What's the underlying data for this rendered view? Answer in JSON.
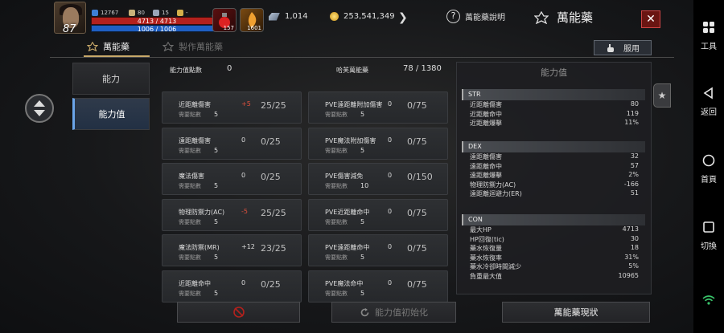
{
  "player": {
    "level": "87",
    "stat_a": "12767",
    "stat_b": "80",
    "stat_c": "15",
    "stat_d": "-",
    "hp": "4713 / 4713",
    "mp": "1006 / 1006"
  },
  "quickslots": [
    {
      "count": "157"
    },
    {
      "count": "1601"
    }
  ],
  "resources": {
    "diamonds": "1,014",
    "gold": "253,541,349"
  },
  "header": {
    "help_label": "萬能藥說明",
    "title": "萬能藥",
    "close": "✕"
  },
  "tabs": {
    "panacea": "萬能藥",
    "craft": "製作萬能藥",
    "use_button": "服用"
  },
  "sidemenu": [
    {
      "label": "能力"
    },
    {
      "label": "能力值"
    }
  ],
  "points": {
    "label": "能力值點數",
    "value": "0",
    "consumed_label": "哈芙萬能藥",
    "consumed_value": "78 / 1380"
  },
  "cards": [
    {
      "name": "近距離傷害",
      "sub": "需要點數",
      "pts": "5",
      "bonus": "+5",
      "value": "25/25",
      "color": "red"
    },
    {
      "name": "PVE遠距離附加傷害",
      "sub": "需要點數",
      "pts": "5",
      "bonus": "0",
      "value": "0/75",
      "color": "zero"
    },
    {
      "name": "遠距離傷害",
      "sub": "需要點數",
      "pts": "5",
      "bonus": "0",
      "value": "0/25",
      "color": "zero"
    },
    {
      "name": "PVE魔法附加傷害",
      "sub": "需要點數",
      "pts": "5",
      "bonus": "0",
      "value": "0/75",
      "color": "zero"
    },
    {
      "name": "魔法傷害",
      "sub": "需要點數",
      "pts": "5",
      "bonus": "0",
      "value": "0/25",
      "color": "zero"
    },
    {
      "name": "PVE傷害減免",
      "sub": "需要點數",
      "pts": "10",
      "bonus": "0",
      "value": "0/150",
      "color": "zero"
    },
    {
      "name": "物理防禦力(AC)",
      "sub": "需要點數",
      "pts": "5",
      "bonus": "-5",
      "value": "25/25",
      "color": "red"
    },
    {
      "name": "PVE近距離命中",
      "sub": "需要點數",
      "pts": "5",
      "bonus": "0",
      "value": "0/75",
      "color": "zero"
    },
    {
      "name": "魔法防禦(MR)",
      "sub": "需要點數",
      "pts": "5",
      "bonus": "+12",
      "value": "23/25",
      "color": "zero"
    },
    {
      "name": "PVE遠距離命中",
      "sub": "需要點數",
      "pts": "5",
      "bonus": "0",
      "value": "0/75",
      "color": "zero"
    },
    {
      "name": "近距離命中",
      "sub": "需要點數",
      "pts": "5",
      "bonus": "0",
      "value": "0/25",
      "color": "zero"
    },
    {
      "name": "PVE魔法命中",
      "sub": "需要點數",
      "pts": "5",
      "bonus": "0",
      "value": "0/75",
      "color": "zero"
    }
  ],
  "stats_panel": {
    "title": "能力值",
    "sections": [
      {
        "name": "STR",
        "rows": [
          {
            "label": "近距離傷害",
            "value": "80"
          },
          {
            "label": "近距離命中",
            "value": "119"
          },
          {
            "label": "近距離爆擊",
            "value": "11%"
          }
        ]
      },
      {
        "name": "DEX",
        "rows": [
          {
            "label": "遠距離傷害",
            "value": "32"
          },
          {
            "label": "遠距離命中",
            "value": "57"
          },
          {
            "label": "遠距離爆擊",
            "value": "2%"
          },
          {
            "label": "物理防禦力(AC)",
            "value": "-166"
          },
          {
            "label": "遠距離迴避力(ER)",
            "value": "51"
          }
        ]
      },
      {
        "name": "CON",
        "rows": [
          {
            "label": "最大HP",
            "value": "4713"
          },
          {
            "label": "HP回復(tic)",
            "value": "30"
          },
          {
            "label": "藥水恢復量",
            "value": "18"
          },
          {
            "label": "藥水恢復率",
            "value": "31%"
          },
          {
            "label": "藥水冷卻時間減少",
            "value": "5%"
          },
          {
            "label": "負重最大值",
            "value": "10965"
          }
        ]
      }
    ]
  },
  "bottom": {
    "reset_label": "能力值初始化",
    "status_label": "萬能藥現狀"
  },
  "sysnav": [
    {
      "label": "工具"
    },
    {
      "label": "返回"
    },
    {
      "label": "首頁"
    },
    {
      "label": "切換"
    }
  ]
}
